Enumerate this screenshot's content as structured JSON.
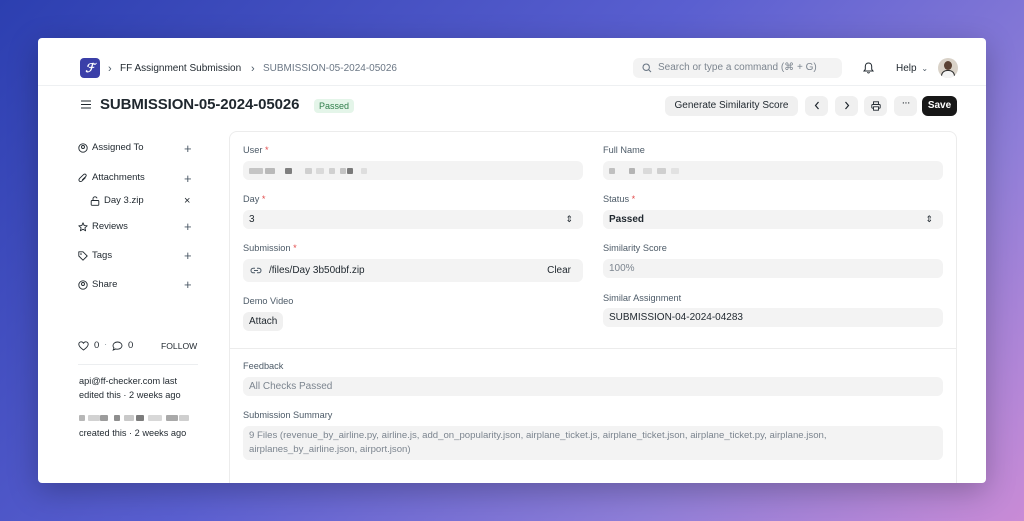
{
  "navbar": {
    "breadcrumbs": [
      "FF Assignment Submission",
      "SUBMISSION-05-2024-05026"
    ],
    "search_placeholder": "Search or type a command (⌘ + G)",
    "help_label": "Help"
  },
  "header": {
    "title": "SUBMISSION-05-2024-05026",
    "status_badge": "Passed",
    "generate_button": "Generate Similarity Score",
    "save_button": "Save"
  },
  "sidebar": {
    "assigned_to": "Assigned To",
    "attachments": "Attachments",
    "attachment_file": "Day 3.zip",
    "reviews": "Reviews",
    "tags": "Tags",
    "share": "Share",
    "likes_count": "0",
    "comments_count": "0",
    "follow_label": "FOLLOW",
    "activity": {
      "editor": "api@ff-checker.com",
      "edited_suffix": "last",
      "edited_time": "edited this · 2 weeks ago",
      "created_time": "created this · 2 weeks ago"
    }
  },
  "form": {
    "user_label": "User",
    "full_name_label": "Full Name",
    "day_label": "Day",
    "day_value": "3",
    "status_label": "Status",
    "status_value": "Passed",
    "submission_label": "Submission",
    "submission_value": "/files/Day 3b50dbf.zip",
    "clear_label": "Clear",
    "similarity_label": "Similarity Score",
    "similarity_value": "100%",
    "demo_video_label": "Demo Video",
    "attach_label": "Attach",
    "similar_assignment_label": "Similar Assignment",
    "similar_assignment_value": "SUBMISSION-04-2024-04283",
    "feedback_label": "Feedback",
    "feedback_value": "All Checks Passed",
    "summary_label": "Submission Summary",
    "summary_value": "9 Files (revenue_by_airline.py, airline.js, add_on_popularity.json, airplane_ticket.js, airplane_ticket.json, airplane_ticket.py, airplane.json, airplanes_by_airline.json, airport.json)"
  },
  "colors": {
    "brand": "#3b3fa8",
    "badge_bg": "#e4f5e9",
    "badge_text": "#2f7d4a",
    "required": "#e24c4c",
    "primary_button": "#171717"
  }
}
